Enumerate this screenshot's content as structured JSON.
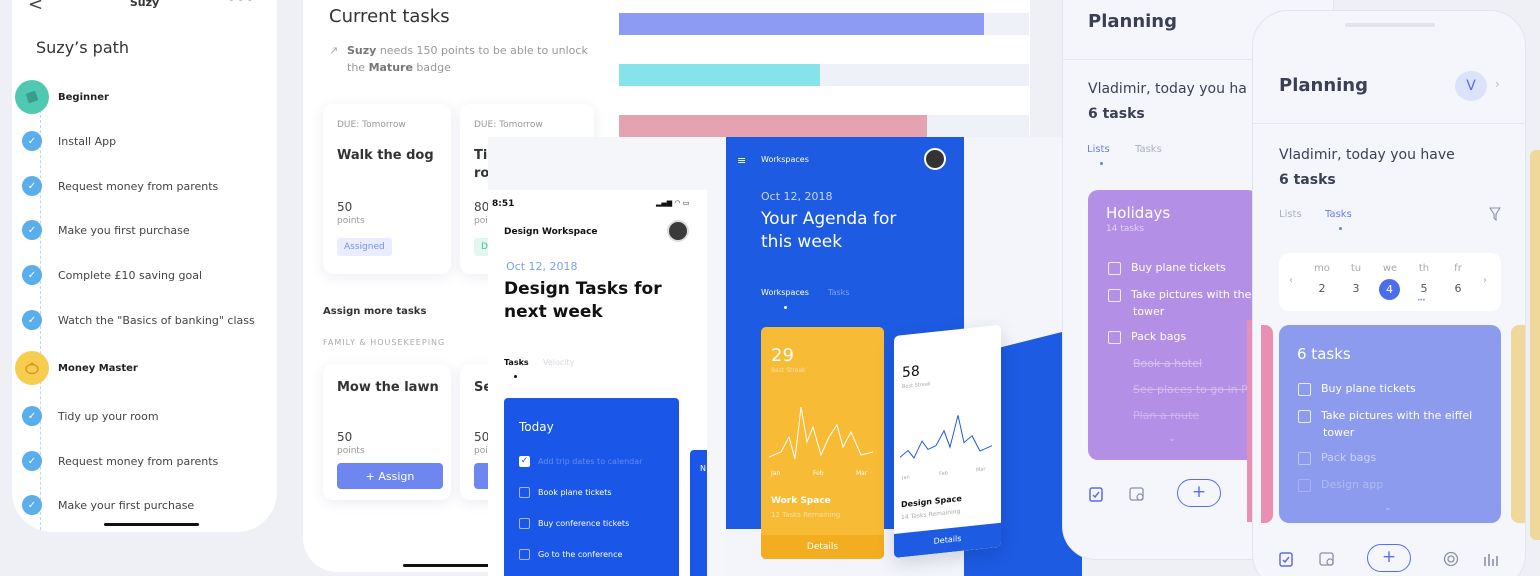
{
  "suzy": {
    "back": "<",
    "name": "Suzy",
    "more": "•••",
    "path_title": "Suzy’s path",
    "steps": [
      {
        "label": "Beginner",
        "level": true
      },
      {
        "label": "Install App"
      },
      {
        "label": "Request money from parents"
      },
      {
        "label": "Make you first purchase"
      },
      {
        "label": "Complete £10 saving goal"
      },
      {
        "label": "Watch the \"Basics of banking\" class"
      },
      {
        "label": "Money Master",
        "level": true
      },
      {
        "label": "Tidy up your room"
      },
      {
        "label": "Request money from parents"
      },
      {
        "label": "Make your first purchase"
      }
    ]
  },
  "current_tasks": {
    "title": "Current tasks",
    "subtitle_name": "Suzy",
    "subtitle_pre": " needs 150 points  to be able to unlock the ",
    "subtitle_badge": "Mature",
    "subtitle_post": " badge",
    "cards": [
      {
        "due": "DUE: Tomorrow",
        "title": "Walk the dog",
        "points": "50",
        "points_label": "points",
        "status": "Assigned"
      },
      {
        "due": "DUE: Tomorrow",
        "title": "Ti",
        "title2": "ro",
        "points": "80",
        "points_label": "points",
        "status": "D"
      }
    ],
    "assign_heading": "Assign more tasks",
    "category": "FAMILY & HOUSEKEEPING",
    "assign_cards": [
      {
        "title": "Mow the lawn",
        "points": "50",
        "points_label": "points",
        "button": "+ Assign"
      },
      {
        "title": "Se",
        "points": "50",
        "points_label": "points"
      }
    ]
  },
  "bars": [
    {
      "fill": 0.89,
      "color": "#8e9bf2"
    },
    {
      "fill": 0.49,
      "color": "#86e3ec"
    },
    {
      "fill": 0.75,
      "color": "#e5a3b2"
    }
  ],
  "design": {
    "time": "8:51",
    "status_icons": "▂▄▆ ◠ ▭",
    "workspace": "Design Workspace",
    "date": "Oct 12, 2018",
    "heading": "Design Tasks for next week",
    "tab_active": "Tasks",
    "tab_inactive": "Velocity",
    "card_title": "Today",
    "items": [
      {
        "label": "Add trip dates to calendar",
        "done": true
      },
      {
        "label": "Book plane tickets",
        "done": false
      },
      {
        "label": "Buy conference tickets",
        "done": false
      },
      {
        "label": "Go to the conference",
        "done": false
      }
    ],
    "peek_letter": "N"
  },
  "agenda": {
    "menu": "Workspaces",
    "date": "Oct 12, 2018",
    "heading": "Your Agenda for this week",
    "tab_active": "Workspaces",
    "tab_inactive": "Tasks",
    "card1": {
      "value": "29",
      "label": "Best Streak",
      "months": [
        "Jan",
        "Feb",
        "Mar"
      ],
      "title": "Work Space",
      "subtitle": "12 Tasks Remaining",
      "button": "Details"
    },
    "card2": {
      "value": "58",
      "label": "Best Streak",
      "months": [
        "Jan",
        "Feb",
        "Mar"
      ],
      "title": "Design Space",
      "subtitle": "14 Tasks Remaining",
      "button": "Details"
    }
  },
  "planning_lists": {
    "title": "Planning",
    "greeting": "Vladimir, today you ha",
    "count": "6 tasks",
    "tab_active": "Lists",
    "tab_inactive": "Tasks",
    "card_title": "Holidays",
    "card_sub": "14 tasks",
    "items": [
      {
        "label": "Buy plane tickets"
      },
      {
        "label": "Take pictures with the",
        "label2": "tower"
      },
      {
        "label": "Pack bags"
      }
    ],
    "done_items": [
      "Book a hotel",
      "See places to go in Pa",
      "Plan a route"
    ],
    "add": "+"
  },
  "planning_tasks": {
    "title": "Planning",
    "avatar": "V",
    "greeting": "Vladimir, today you have",
    "count": "6 tasks",
    "tab_inactive": "Lists",
    "tab_active": "Tasks",
    "days": [
      {
        "name": "mo",
        "num": "2"
      },
      {
        "name": "tu",
        "num": "3"
      },
      {
        "name": "we",
        "num": "4",
        "active": true
      },
      {
        "name": "th",
        "num": "5"
      },
      {
        "name": "fr",
        "num": "6"
      }
    ],
    "card_title": "6 tasks",
    "items": [
      {
        "label": "Buy plane tickets",
        "faded": false
      },
      {
        "label": "Take pictures with the eiffel",
        "label2": "tower",
        "faded": false
      },
      {
        "label": "Pack bags",
        "faded": true
      },
      {
        "label": "Design app",
        "faded": true
      }
    ],
    "add": "+"
  }
}
